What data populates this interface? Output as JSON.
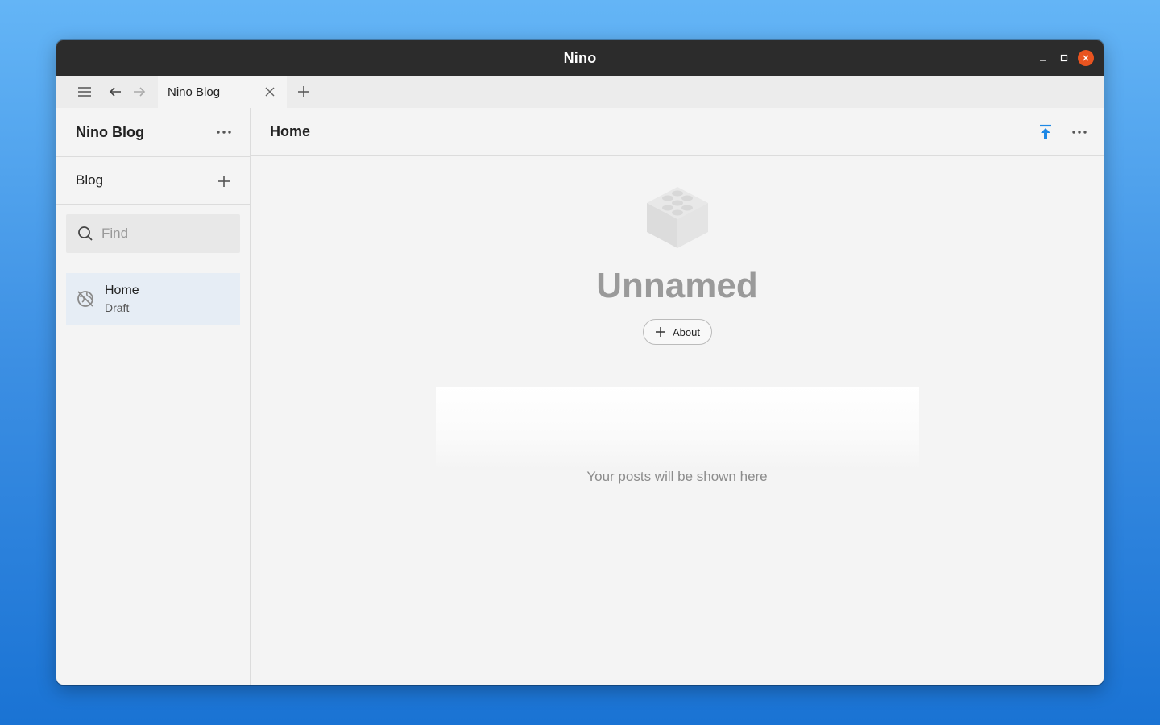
{
  "window": {
    "title": "Nino"
  },
  "tabs": [
    {
      "label": "Nino Blog"
    }
  ],
  "sidebar": {
    "title": "Nino Blog",
    "section_label": "Blog",
    "search": {
      "placeholder": "Find",
      "value": ""
    },
    "pages": [
      {
        "name": "Home",
        "status": "Draft"
      }
    ]
  },
  "main": {
    "title": "Home",
    "site_title": "Unnamed",
    "about_label": "About",
    "posts_empty_text": "Your posts will be shown here"
  },
  "colors": {
    "accent": "#1e88e5",
    "close_button": "#e95420",
    "titlebar": "#2c2c2c",
    "selected_item": "#e6edf5"
  }
}
